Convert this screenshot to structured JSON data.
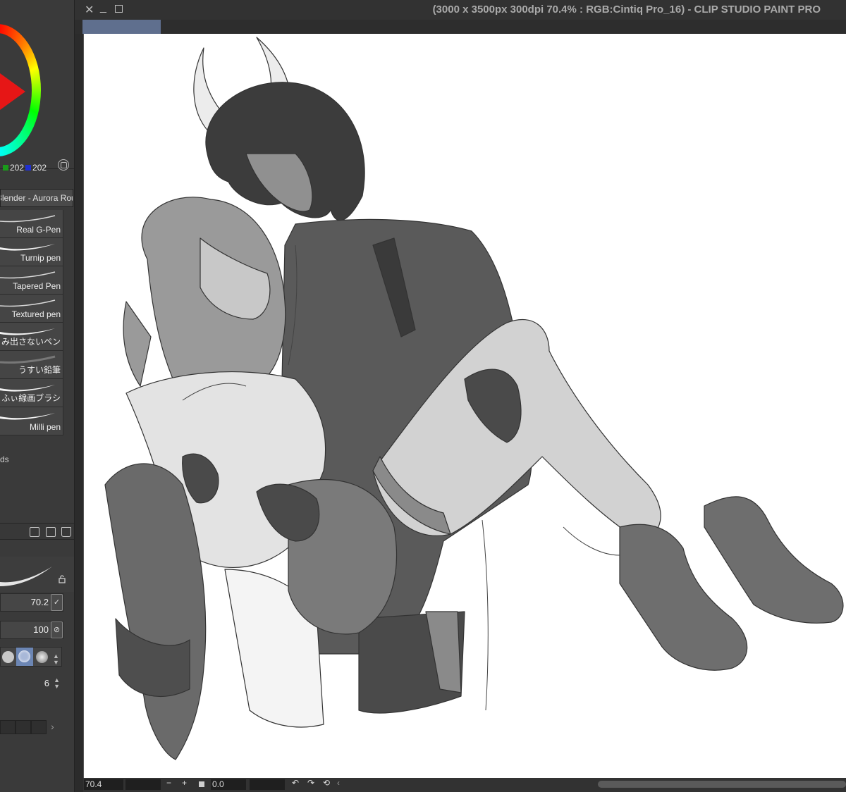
{
  "window": {
    "title": "(3000 x 3500px 300dpi 70.4% : RGB:Cintiq Pro_16)  - CLIP STUDIO PAINT PRO"
  },
  "color": {
    "green_value": "202",
    "blue_value": "202",
    "green_swatch": "#1a9a1a",
    "blue_swatch": "#1f2fd0",
    "main_color": "#e61616"
  },
  "brush_set": {
    "name": "Blender - Aurora Rouge"
  },
  "brushes": [
    {
      "label": "Real G-Pen",
      "icon": "thin-stroke"
    },
    {
      "label": "Turnip pen",
      "icon": "thick-stroke"
    },
    {
      "label": "Tapered Pen",
      "icon": "thin-stroke"
    },
    {
      "label": "Textured pen",
      "icon": "thin-stroke"
    },
    {
      "label": "み出さないペン",
      "icon": "thick-stroke"
    },
    {
      "label": "うすい鉛筆",
      "icon": "pencil-stroke"
    },
    {
      "label": "ふぃ線画ブラシ",
      "icon": "thick-stroke"
    },
    {
      "label": "Milli pen",
      "icon": "thick-stroke"
    }
  ],
  "brush_extra": "ds",
  "tool_props": {
    "size": "70.2",
    "opacity": "100",
    "stabilization": "6"
  },
  "status": {
    "zoom": "70.4",
    "zoom_out": "−",
    "zoom_in": "+",
    "rotation": "0.0",
    "rotate_left": "↶",
    "rotate_right": "↷",
    "reset_rotation": "⟲",
    "collapse": "‹"
  },
  "titlebar": {
    "close": "✕",
    "minimize": "_"
  },
  "icons": {
    "spin": "▲▼",
    "lock": "lock-icon",
    "arrow": "›"
  }
}
